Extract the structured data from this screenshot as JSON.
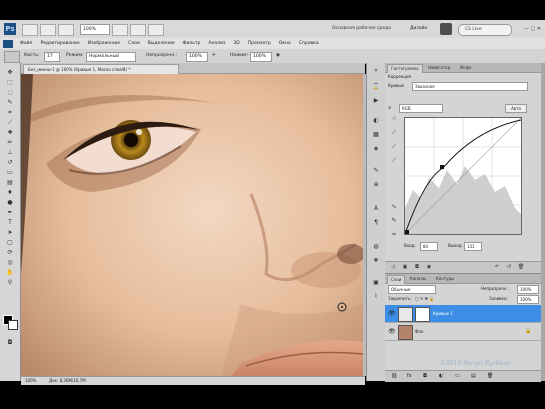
{
  "app": {
    "logo": "Ps",
    "zoom": "100%",
    "workspace": "Основная рабочая среда",
    "design": "Дизайн",
    "cslive": "CS Live",
    "window_controls": "— ▢ ✕"
  },
  "menu": {
    "items": [
      "Файл",
      "Редактирование",
      "Изображение",
      "Слои",
      "Выделение",
      "Фильтр",
      "Анализ",
      "3D",
      "Просмотр",
      "Окно",
      "Справка"
    ]
  },
  "options": {
    "brush_label": "Кисть:",
    "brush_size": "17",
    "mode_label": "Режим:",
    "mode_value": "Нормальный",
    "opacity_label": "Непрозрачн.:",
    "opacity_value": "100%",
    "flow_label": "Нажим:",
    "flow_value": "100%"
  },
  "document": {
    "tab_title": "Без_имени-1 @ 100% (Кривые 1, Маска слоя/8) *",
    "status_zoom": "100%",
    "status_doc": "Док: 8,36M/16,7M"
  },
  "adjust_panel": {
    "tabs": [
      "Гистограмма",
      "Навигатор",
      "Инфо"
    ],
    "header": "Коррекция",
    "preset_label": "Кривые",
    "preset_value": "Заказная",
    "channel_value": "RGB",
    "auto_button": "Авто",
    "input_label": "Вход:",
    "input_value": "84",
    "output_label": "Выход:",
    "output_value": "131"
  },
  "layers_panel": {
    "tabs": [
      "Слои",
      "Каналы",
      "Контуры"
    ],
    "blend_mode": "Обычные",
    "opacity_label": "Непрозрачн.:",
    "opacity_value": "100%",
    "lock_label": "Закрепить:",
    "fill_label": "Заливка:",
    "fill_value": "100%",
    "layers": [
      {
        "name": "Кривые 1",
        "active": true,
        "adjust": true
      },
      {
        "name": "Фон",
        "active": false,
        "adjust": false
      }
    ]
  },
  "watermark": "©2010 Sergei Ryzhkov",
  "colors": {
    "accent": "#3d8ee6",
    "panel_bg": "#d4d4d4"
  }
}
